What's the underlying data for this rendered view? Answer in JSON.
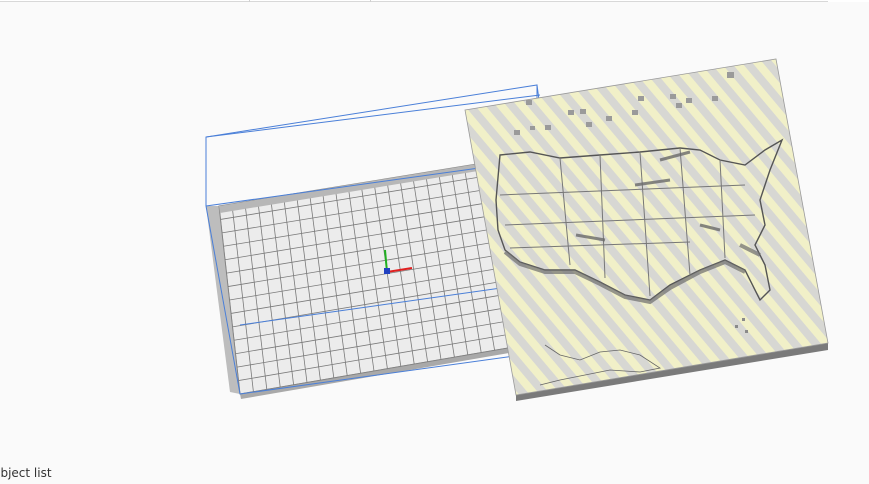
{
  "bottom_panel": {
    "object_list_label": "Object list"
  },
  "colors": {
    "viewport_bg": "#fafafa",
    "bed_surface": "#ececec",
    "bed_grid_line": "#7a7a7a",
    "bed_side": "#bcbcbc",
    "build_volume_edge": "#4a7fd8",
    "model_stripe_light": "#f1f0c8",
    "model_stripe_dark": "#d7d7d3",
    "model_shadow": "#6d6d6d",
    "axis_x": "#e02020",
    "axis_y": "#20b020",
    "axis_z": "#2040c0"
  },
  "icons": {
    "origin": "xyz-axes-icon"
  }
}
